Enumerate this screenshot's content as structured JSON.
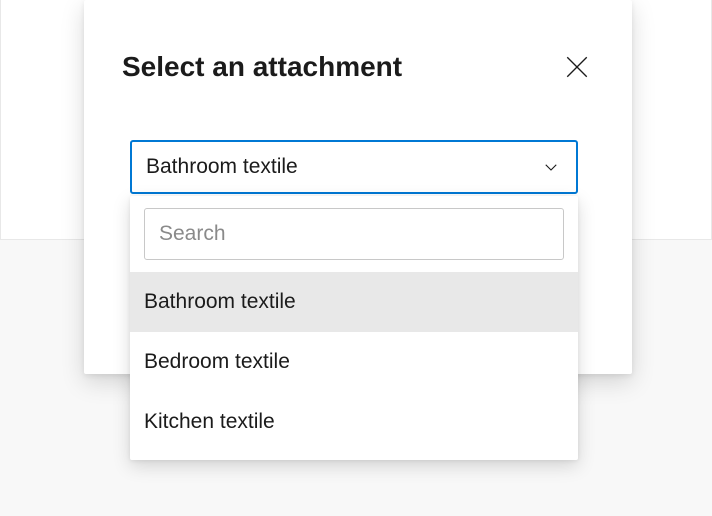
{
  "dialog": {
    "title": "Select an attachment"
  },
  "select": {
    "value": "Bathroom textile",
    "search_placeholder": "Search",
    "options": [
      {
        "label": "Bathroom textile",
        "selected": true
      },
      {
        "label": "Bedroom textile",
        "selected": false
      },
      {
        "label": "Kitchen textile",
        "selected": false
      }
    ]
  }
}
